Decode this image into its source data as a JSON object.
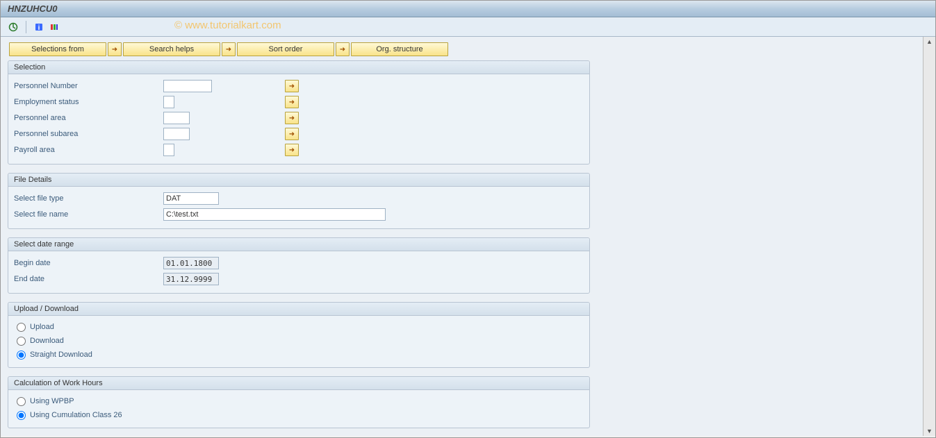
{
  "title": "HNZUHCU0",
  "watermark": "© www.tutorialkart.com",
  "topButtons": {
    "selections_from": "Selections from",
    "search_helps": "Search helps",
    "sort_order": "Sort order",
    "org_structure": "Org. structure"
  },
  "groups": {
    "selection": {
      "title": "Selection",
      "fields": {
        "personnel_number": "Personnel Number",
        "employment_status": "Employment status",
        "personnel_area": "Personnel area",
        "personnel_subarea": "Personnel subarea",
        "payroll_area": "Payroll area"
      },
      "values": {
        "personnel_number": "",
        "employment_status": "",
        "personnel_area": "",
        "personnel_subarea": "",
        "payroll_area": ""
      }
    },
    "file_details": {
      "title": "File Details",
      "fields": {
        "select_file_type": "Select file type",
        "select_file_name": "Select file name"
      },
      "values": {
        "select_file_type": "DAT",
        "select_file_name": "C:\\test.txt"
      }
    },
    "date_range": {
      "title": "Select date range",
      "fields": {
        "begin_date": "Begin date",
        "end_date": "End date"
      },
      "values": {
        "begin_date": "01.01.1800",
        "end_date": "31.12.9999"
      }
    },
    "upload_download": {
      "title": "Upload / Download",
      "options": {
        "upload": "Upload",
        "download": "Download",
        "straight_download": "Straight Download"
      },
      "selected": "straight_download"
    },
    "calc_work_hours": {
      "title": "Calculation of Work Hours",
      "options": {
        "using_wpbp": "Using WPBP",
        "using_cum26": "Using Cumulation Class 26"
      },
      "selected": "using_cum26"
    }
  }
}
